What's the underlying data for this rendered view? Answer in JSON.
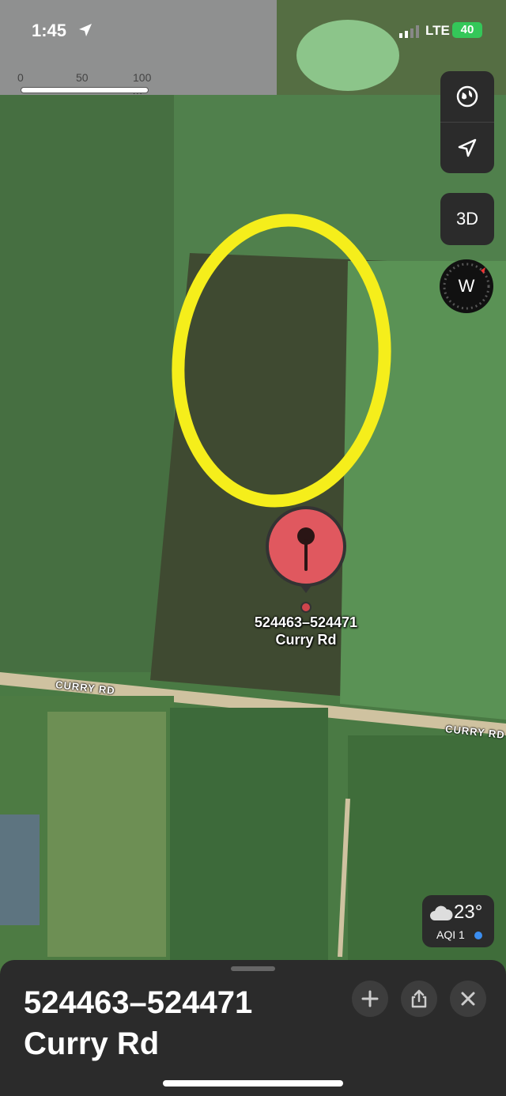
{
  "status_bar": {
    "time": "1:45",
    "network": "LTE",
    "battery": "40"
  },
  "scale": {
    "ticks": [
      "0",
      "50",
      "100 m"
    ]
  },
  "map_controls": {
    "globe_icon": "globe-icon",
    "location_icon": "location-arrow-icon",
    "three_d_label": "3D",
    "compass_label": "W"
  },
  "pin": {
    "label_line1": "524463–524471",
    "label_line2": "Curry Rd"
  },
  "roads": {
    "road1": "CURRY RD",
    "road2": "CURRY RD"
  },
  "weather": {
    "temp": "23°",
    "aqi": "AQI 1"
  },
  "sheet": {
    "title_line1": "524463–524471",
    "title_line2": "Curry Rd"
  },
  "colors": {
    "field_green": "#4f7f4a",
    "highlight": "#f5ee1b",
    "pin": "#e0585f",
    "battery": "#34c759",
    "panel": "#2b2b2b"
  }
}
